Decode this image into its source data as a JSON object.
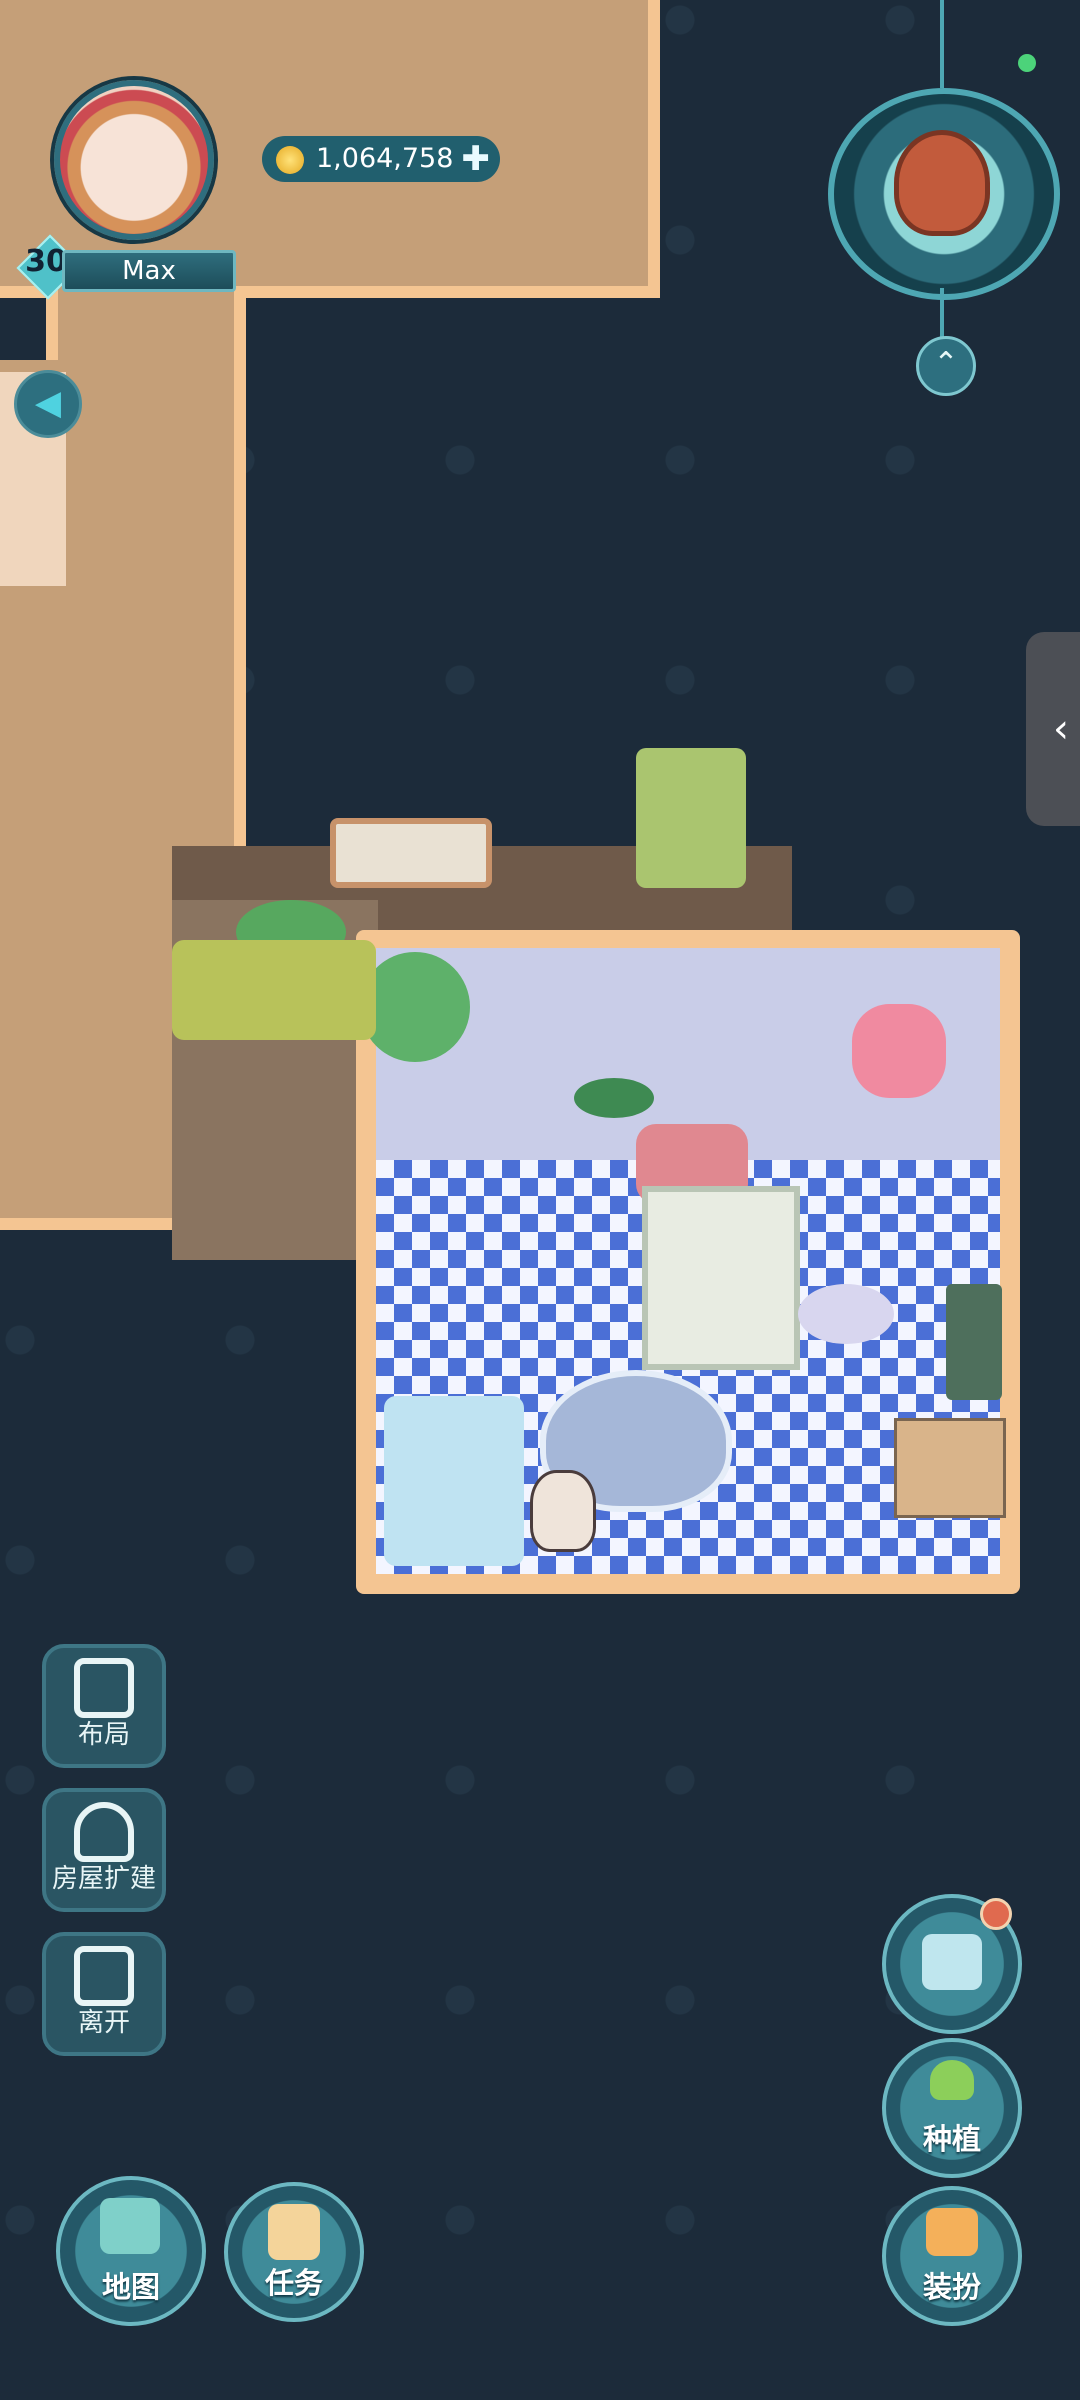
{
  "player": {
    "level": "30",
    "name": "Max",
    "coins": "1,064,758"
  },
  "left_menu": [
    {
      "label": "布局",
      "icon": "layout-icon"
    },
    {
      "label": "房屋扩建",
      "icon": "house-expand-icon"
    },
    {
      "label": "离开",
      "icon": "exit-icon"
    }
  ],
  "bottom_left": {
    "map_label": "地图",
    "tasks_label": "任务"
  },
  "bottom_right": {
    "catalog_icon": "furniture-catalog-icon",
    "plant_label": "种植",
    "dressup_label": "装扮"
  },
  "icons": {
    "expand_up": "double-chevron-up-icon",
    "side_tab": "chevron-left-icon",
    "left_tab": "triangle-left-icon"
  },
  "colors": {
    "background": "#1c2b3a",
    "floor_border": "#f4c592",
    "accent": "#4ea7b3"
  }
}
